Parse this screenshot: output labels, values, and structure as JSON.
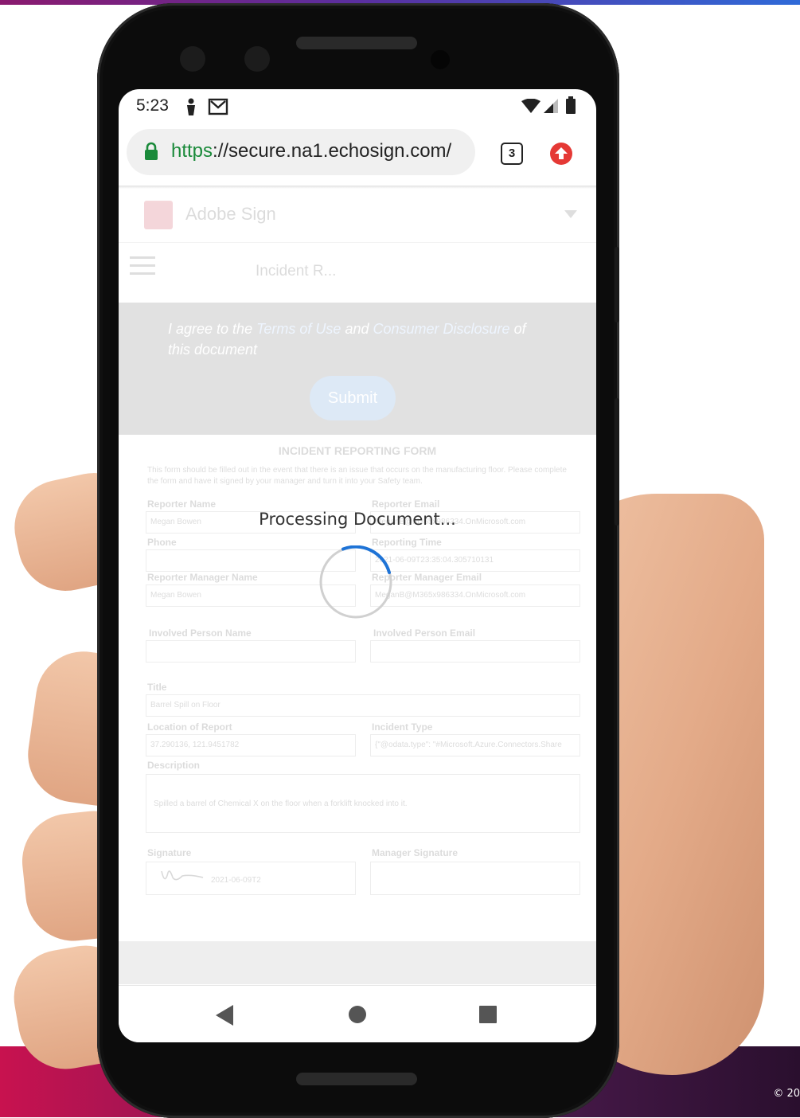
{
  "status_bar": {
    "time": "5:23"
  },
  "browser": {
    "url_scheme": "https",
    "url_rest": "://secure.na1.echosign.com/",
    "tab_count": "3"
  },
  "page": {
    "brand": "Adobe Sign",
    "document_title": "Incident R...",
    "consent": {
      "prefix": "I agree to the ",
      "terms_link": "Terms of Use",
      "middle": " and ",
      "disclosure_link": "Consumer Disclosure",
      "suffix": " of this document"
    },
    "submit_label": "Submit",
    "form_title": "INCIDENT REPORTING FORM",
    "form_description": "This form should be filled out in the event that there is an issue that occurs on the manufacturing floor. Please complete the form and have it signed by your manager and turn it into your Safety team.",
    "fields": {
      "reporter_name_label": "Reporter Name",
      "reporter_name_value": "Megan Bowen",
      "reporter_email_label": "Reporter Email",
      "reporter_email_value": "MeganB@M365x986334.OnMicrosoft.com",
      "phone_label": "Phone",
      "reporting_time_label": "Reporting Time",
      "reporting_time_value": "2021-06-09T23:35:04.305710131",
      "manager_name_label": "Reporter Manager Name",
      "manager_name_value": "Megan Bowen",
      "manager_email_label": "Reporter Manager Email",
      "manager_email_value": "MeganB@M365x986334.OnMicrosoft.com",
      "involved_name_label": "Involved Person Name",
      "involved_email_label": "Involved Person Email",
      "title_label": "Title",
      "title_value": "Barrel Spill on Floor",
      "location_label": "Location of Report",
      "location_value": "37.290136, 121.9451782",
      "incident_type_label": "Incident Type",
      "incident_type_value": "{\"@odata.type\": \"#Microsoft.Azure.Connectors.Share",
      "description_label": "Description",
      "description_value": "Spilled a barrel of Chemical X on the floor when a forklift knocked into it.",
      "signature_label": "Signature",
      "signature_date": "2021-06-09T2",
      "manager_signature_label": "Manager Signature"
    }
  },
  "overlay": {
    "processing_text": "Processing Document..."
  },
  "footer": {
    "copyright": "© 20"
  },
  "colors": {
    "spinner_accent": "#1e73d6",
    "spinner_track": "#d0d0d0",
    "lock_green": "#1a8a3a",
    "update_red": "#e53935"
  }
}
